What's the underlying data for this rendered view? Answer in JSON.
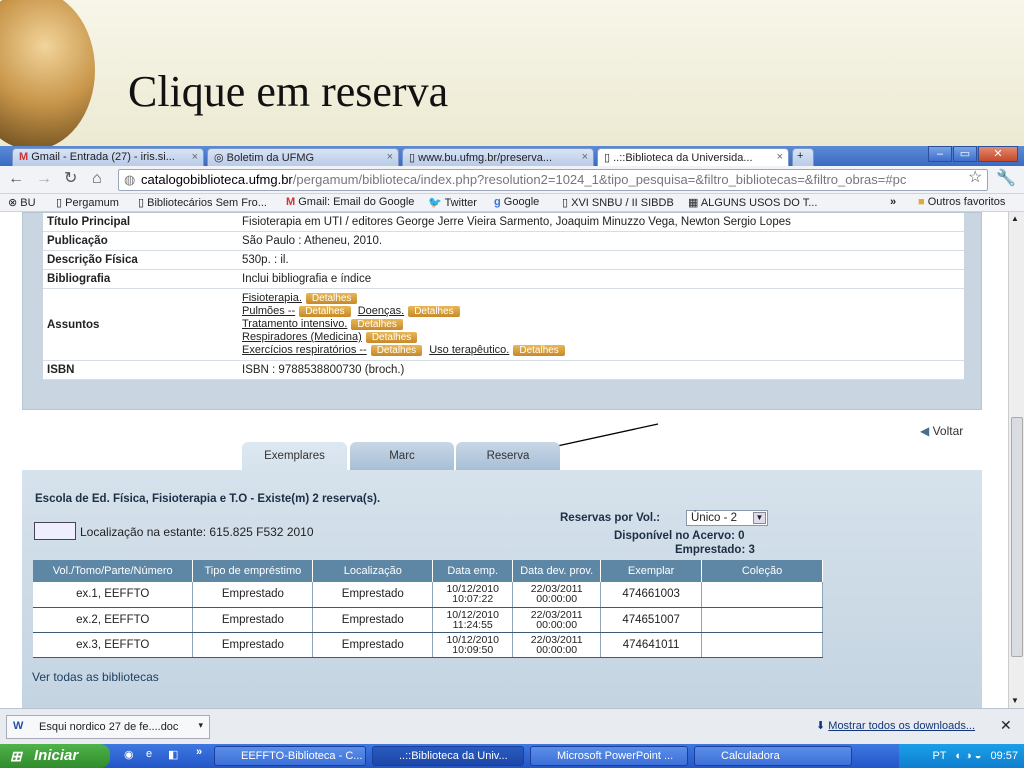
{
  "slide": {
    "title": "Clique em reserva"
  },
  "browser": {
    "tabs": [
      {
        "label": "Gmail - Entrada (27) - iris.si..."
      },
      {
        "label": "Boletim da UFMG"
      },
      {
        "label": "www.bu.ufmg.br/preserva..."
      },
      {
        "label": "..::Biblioteca da Universida..."
      }
    ],
    "url_domain": "catalogobiblioteca.ufmg.br",
    "url_path": "/pergamum/biblioteca/index.php?resolution2=1024_1&tipo_pesquisa=&filtro_bibliotecas=&filtro_obras=#pc",
    "bookmarks": [
      "BU",
      "Pergamum",
      "Bibliotecários Sem Fro...",
      "Gmail: Email do Google",
      "Twitter",
      "Google",
      "XVI SNBU / II SIBDB",
      "ALGUNS USOS DO T...",
      "Outros favoritos"
    ]
  },
  "details": {
    "rows": [
      {
        "key": "Título Principal",
        "value": "Fisioterapia em UTI /   editores George Jerre Vieira Sarmento, Joaquim Minuzzo Vega, Newton Sergio Lopes"
      },
      {
        "key": "Publicação",
        "value": "São Paulo :   Atheneu,   2010."
      },
      {
        "key": "Descrição Física",
        "value": "530p. :   il."
      },
      {
        "key": "Bibliografia",
        "value": "Inclui bibliografia e índice"
      },
      {
        "key": "Assuntos"
      },
      {
        "key": "ISBN",
        "value": "ISBN : 9788538800730 (broch.)"
      }
    ],
    "subjects": [
      "Fisioterapia.",
      "Pulmões --",
      "Doenças.",
      "Tratamento intensivo.",
      "Respiradores (Medicina)",
      "Exercícios respiratórios --",
      "Uso terapêutico."
    ],
    "detail_label": "Detalhes"
  },
  "voltar": "Voltar",
  "tabs": [
    "Exemplares",
    "Marc",
    "Reserva"
  ],
  "library": {
    "title": "Escola de Ed. Física, Fisioterapia e T.O  -  Existe(m) 2 reserva(s).",
    "location": "Localização na estante: 615.825 F532 2010",
    "reservas_label": "Reservas por Vol.:",
    "reservas_value": "Único - 2",
    "disponivel": "Disponível no Acervo: 0",
    "emprestado": "Emprestado: 3"
  },
  "table": {
    "headers": [
      "Vol./Tomo/Parte/Número",
      "Tipo de empréstimo",
      "Localização",
      "Data emp.",
      "Data dev. prov.",
      "Exemplar",
      "Coleção"
    ],
    "rows": [
      [
        "ex.1, EEFFTO",
        "Emprestado",
        "Emprestado",
        "10/12/2010 10:07:22",
        "22/03/2011 00:00:00",
        "474661003",
        ""
      ],
      [
        "ex.2, EEFFTO",
        "Emprestado",
        "Emprestado",
        "10/12/2010 11:24:55",
        "22/03/2011 00:00:00",
        "474651007",
        ""
      ],
      [
        "ex.3, EEFFTO",
        "Emprestado",
        "Emprestado",
        "10/12/2010 10:09:50",
        "22/03/2011 00:00:00",
        "474641011",
        ""
      ]
    ]
  },
  "ver_todas": "Ver todas as bibliotecas",
  "download": {
    "file": "Esqui nordico 27 de fe....doc",
    "show_all": "Mostrar todos os downloads..."
  },
  "taskbar": {
    "start": "Iniciar",
    "tasks": [
      "EEFFTO-Biblioteca - C...",
      "..::Biblioteca da Univ...",
      "Microsoft PowerPoint ...",
      "Calculadora"
    ],
    "lang": "PT",
    "time": "09:57"
  }
}
